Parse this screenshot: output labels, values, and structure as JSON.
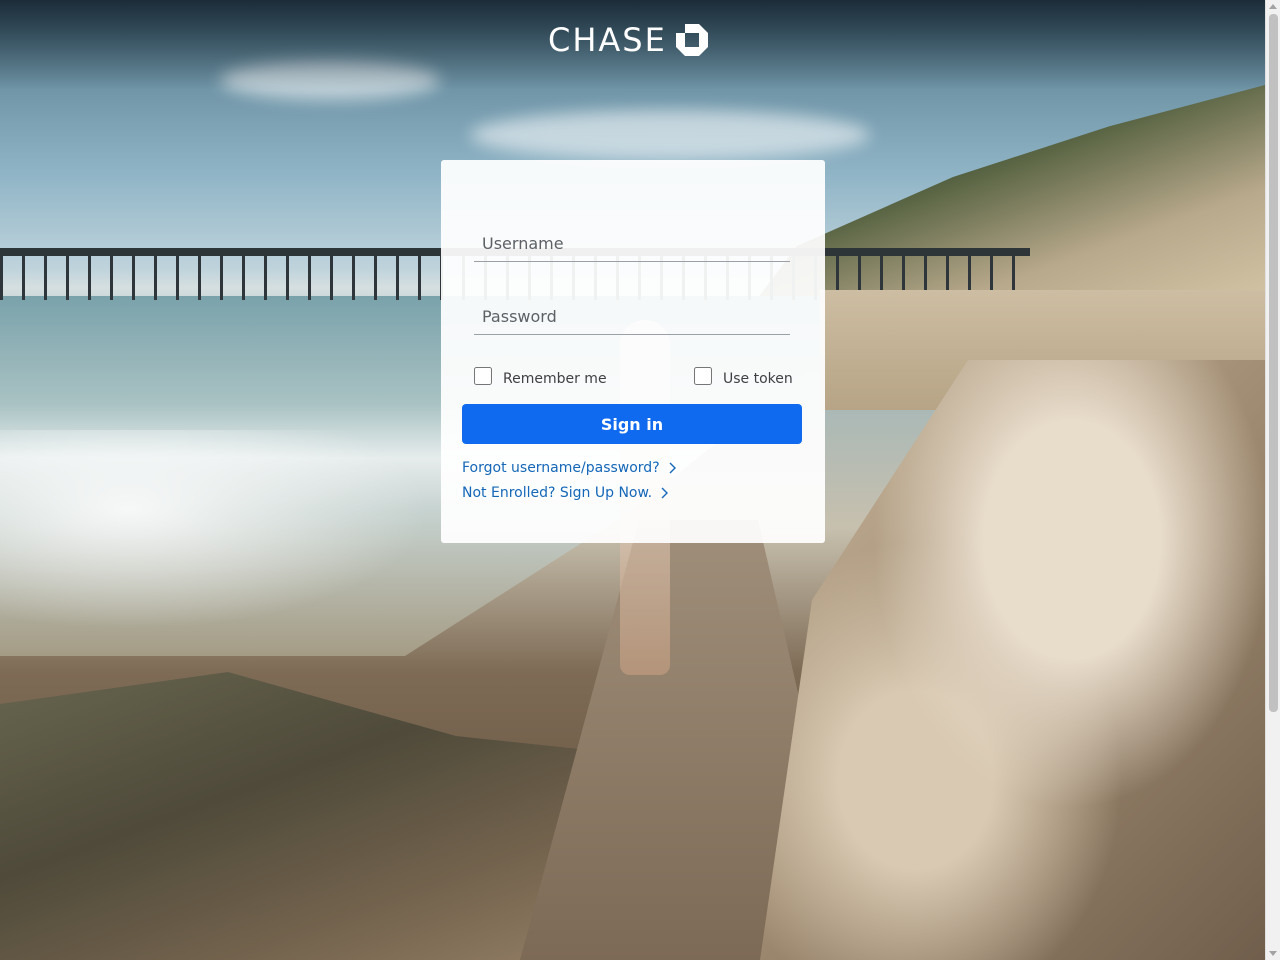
{
  "brand": {
    "logo_text": "CHASE",
    "logo_icon": "chase-octagon-icon"
  },
  "login": {
    "username_placeholder": "Username",
    "password_placeholder": "Password",
    "remember_label": "Remember me",
    "token_label": "Use token",
    "signin_label": "Sign in",
    "forgot_link": "Forgot username/password?",
    "enroll_link": "Not Enrolled? Sign Up Now."
  },
  "icons": {
    "forgot_chevron": "chevron-right-icon",
    "enroll_chevron": "chevron-right-icon"
  },
  "colors": {
    "primary_button": "#0f6af0",
    "link": "#1467b9",
    "card_background": "#ffffff"
  }
}
